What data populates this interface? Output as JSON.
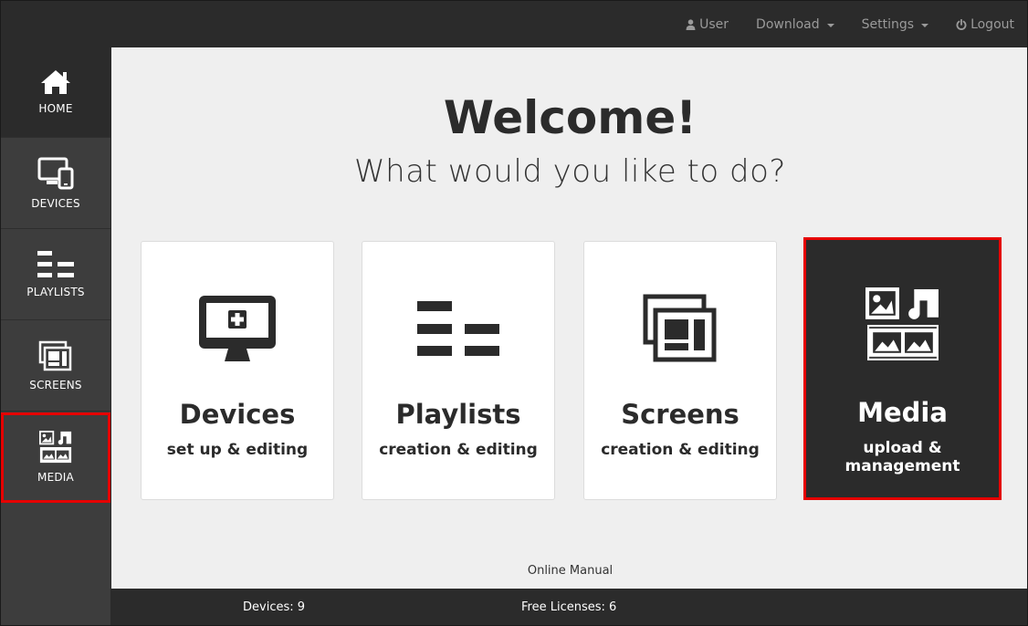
{
  "topnav": {
    "user": "User",
    "download": "Download",
    "settings": "Settings",
    "logout": "Logout"
  },
  "sidebar": {
    "items": [
      {
        "label": "HOME",
        "icon": "home-icon"
      },
      {
        "label": "DEVICES",
        "icon": "devices-icon"
      },
      {
        "label": "PLAYLISTS",
        "icon": "playlists-icon"
      },
      {
        "label": "SCREENS",
        "icon": "screens-icon"
      },
      {
        "label": "MEDIA",
        "icon": "media-icon"
      }
    ]
  },
  "main": {
    "title": "Welcome!",
    "subtitle": "What would you like to do?",
    "cards": [
      {
        "title": "Devices",
        "sub": "set up & editing",
        "icon": "monitor-plus-icon"
      },
      {
        "title": "Playlists",
        "sub": "creation & editing",
        "icon": "playlists-icon"
      },
      {
        "title": "Screens",
        "sub": "creation & editing",
        "icon": "screens-icon"
      },
      {
        "title": "Media",
        "sub_line1": "upload &",
        "sub_line2": "management",
        "icon": "media-icon"
      }
    ],
    "manual_link": "Online Manual"
  },
  "footer": {
    "devices": "Devices: 9",
    "licenses": "Free Licenses: 6"
  },
  "colors": {
    "dark": "#2b2b2b",
    "sidebar": "#3d3d3d",
    "background": "#efefef",
    "highlight": "#e60000"
  }
}
